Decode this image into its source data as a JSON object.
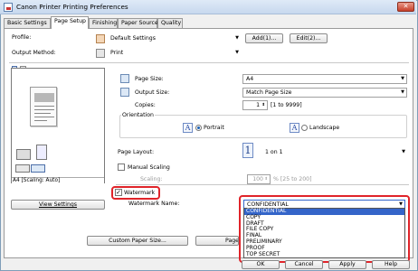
{
  "window": {
    "title": "Canon Printer Printing Preferences",
    "close_glyph": "✕"
  },
  "tabs": [
    {
      "label": "Basic Settings",
      "active": false
    },
    {
      "label": "Page Setup",
      "active": true
    },
    {
      "label": "Finishing",
      "active": false
    },
    {
      "label": "Paper Source",
      "active": false
    },
    {
      "label": "Quality",
      "active": false
    }
  ],
  "profile": {
    "label": "Profile:",
    "value": "Default Settings",
    "add_button": "Add(1)...",
    "edit_button": "Edit(2)..."
  },
  "output_method": {
    "label": "Output Method:",
    "value": "Print"
  },
  "page_size": {
    "label": "Page Size:",
    "value": "A4"
  },
  "output_size": {
    "label": "Output Size:",
    "value": "Match Page Size"
  },
  "copies": {
    "label": "Copies:",
    "value": "1",
    "range": "[1 to 9999]"
  },
  "orientation": {
    "label": "Orientation",
    "portrait": "Portrait",
    "landscape": "Landscape",
    "selected": "Portrait",
    "glyph": "A"
  },
  "page_layout": {
    "label": "Page Layout:",
    "value": "1 on 1",
    "icon_text": "1"
  },
  "manual_scaling": {
    "label": "Manual Scaling",
    "checked": false,
    "scaling_label": "Scaling:",
    "scaling_value": "100",
    "scaling_range": "% [25 to 200]"
  },
  "watermark": {
    "label": "Watermark",
    "checked": true,
    "name_label": "Watermark Name:",
    "value": "CONFIDENTIAL"
  },
  "watermark_options": [
    "CONFIDENTIAL",
    "COPY",
    "DRAFT",
    "FILE COPY",
    "FINAL",
    "PRELIMINARY",
    "PROOF",
    "TOP SECRET"
  ],
  "preview": {
    "caption": "A4 [Scaling: Auto]"
  },
  "buttons": {
    "view_settings": "View Settings",
    "custom_paper_size": "Custom Paper Size...",
    "page_options": "Page",
    "ok": "OK",
    "cancel": "Cancel",
    "apply": "Apply",
    "help": "Help"
  },
  "colors": {
    "highlight": "#e0242a",
    "selection": "#3465c9"
  }
}
